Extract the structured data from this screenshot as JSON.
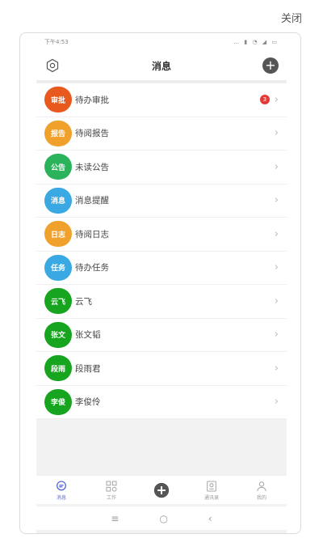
{
  "close_label": "关闭",
  "status_bar": {
    "time": "下午4:53",
    "icons": "… ▮ ◔ ◢ ▭"
  },
  "header": {
    "title": "消息"
  },
  "items": [
    {
      "avatar": "审批",
      "label": "待办审批",
      "color": "#e8591d",
      "badge": "3"
    },
    {
      "avatar": "报告",
      "label": "待阅报告",
      "color": "#f0a12b",
      "badge": ""
    },
    {
      "avatar": "公告",
      "label": "未读公告",
      "color": "#2bb35b",
      "badge": ""
    },
    {
      "avatar": "消息",
      "label": "消息提醒",
      "color": "#3aa8e2",
      "badge": ""
    },
    {
      "avatar": "日志",
      "label": "待阅日志",
      "color": "#f0a12b",
      "badge": ""
    },
    {
      "avatar": "任务",
      "label": "待办任务",
      "color": "#3aa8e2",
      "badge": ""
    },
    {
      "avatar": "云飞",
      "label": "云飞",
      "color": "#17a51f",
      "badge": ""
    },
    {
      "avatar": "张文",
      "label": "张文韬",
      "color": "#17a51f",
      "badge": ""
    },
    {
      "avatar": "段雨",
      "label": "段雨君",
      "color": "#17a51f",
      "badge": ""
    },
    {
      "avatar": "李俊",
      "label": "李俊伶",
      "color": "#17a51f",
      "badge": ""
    }
  ],
  "tabs": [
    {
      "label": "消息",
      "icon": "chat-icon",
      "active": true
    },
    {
      "label": "工作",
      "icon": "apps-icon",
      "active": false
    },
    {
      "label": "",
      "icon": "plus-icon",
      "active": false
    },
    {
      "label": "通讯录",
      "icon": "contacts-icon",
      "active": false
    },
    {
      "label": "我的",
      "icon": "person-icon",
      "active": false
    }
  ],
  "android_nav": {
    "menu": "≡",
    "home": "○",
    "back": "‹"
  },
  "colors": {
    "accent": "#5b6bd6",
    "badge": "#e53935"
  }
}
